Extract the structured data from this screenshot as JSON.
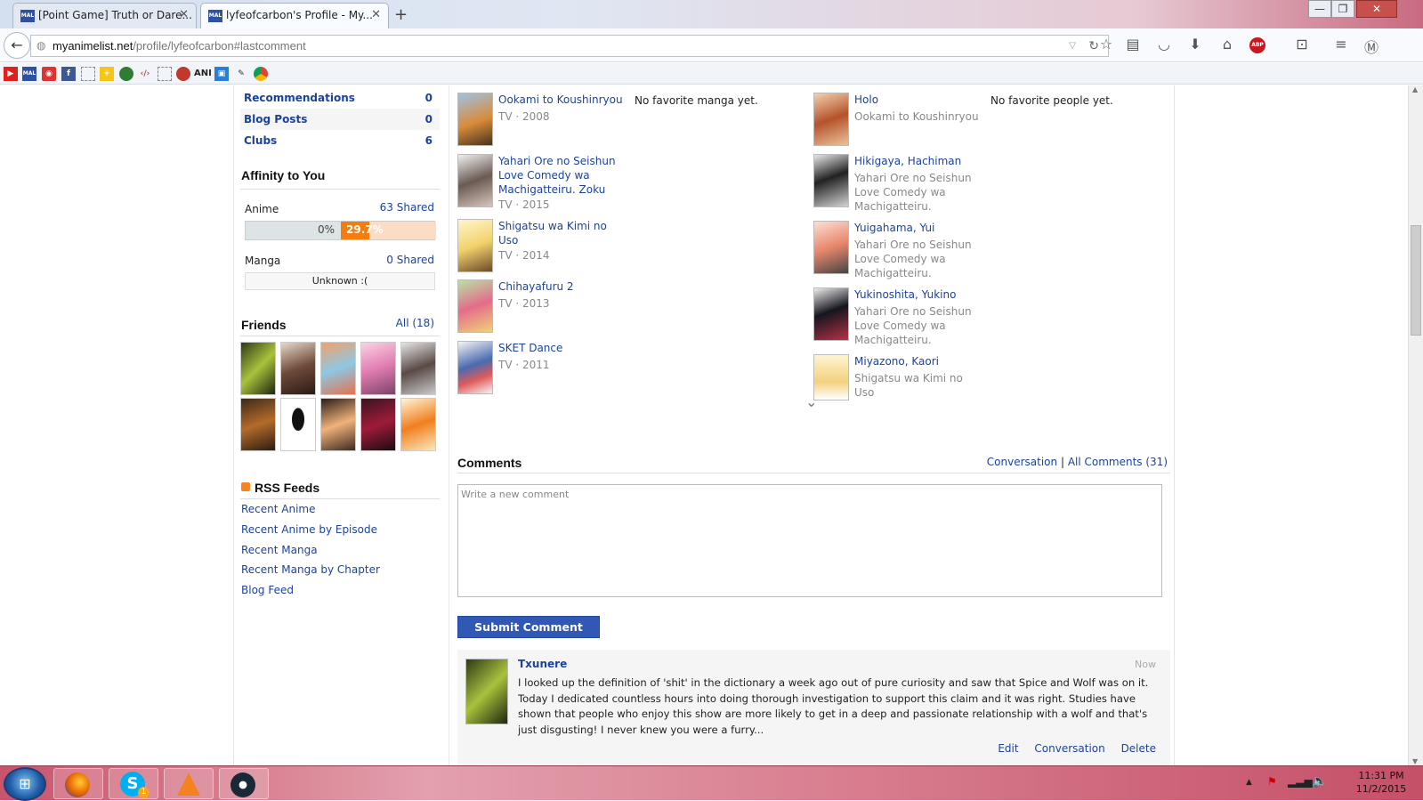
{
  "browser": {
    "tabs": [
      {
        "title": "[Point Game] Truth or Dare...",
        "active": false
      },
      {
        "title": "lyfeofcarbon's Profile - My...",
        "active": true
      }
    ],
    "new_tab_label": "+",
    "window_controls": {
      "minimize": "—",
      "restore": "❐",
      "close": "✕"
    },
    "url_host": "myanimelist.net",
    "url_path": "/profile/lyfeofcarbon#lastcomment",
    "bookmarks": [
      "youtube-icon",
      "mal-icon",
      "record-icon",
      "facebook-icon",
      "blank-icon",
      "plus-icon",
      "green-icon",
      "code-icon",
      "blank-icon",
      "pokeball-icon",
      "ANI",
      "image-icon",
      "brush-icon",
      "chrome-icon"
    ],
    "bookmark_ani_label": "ANI",
    "abp_label": "ABP"
  },
  "stats": [
    {
      "label": "Recommendations",
      "value": "0"
    },
    {
      "label": "Blog Posts",
      "value": "0"
    },
    {
      "label": "Clubs",
      "value": "6"
    }
  ],
  "affinity": {
    "heading": "Affinity to You",
    "anime_label": "Anime",
    "anime_shared": "63 Shared",
    "anime_left_pct": "0%",
    "anime_right_pct": "29.7%",
    "anime_fill": 0.297,
    "manga_label": "Manga",
    "manga_shared": "0 Shared",
    "manga_value": "Unknown :("
  },
  "friends": {
    "heading": "Friends",
    "all_link": "All (18)",
    "count_shown": 10
  },
  "rss": {
    "heading": "RSS Feeds",
    "links": [
      "Recent Anime",
      "Recent Anime by Episode",
      "Recent Manga",
      "Recent Manga by Chapter",
      "Blog Feed"
    ]
  },
  "favorites": {
    "anime": [
      {
        "title": "Ookami to Koushinryou",
        "meta": "TV · 2008"
      },
      {
        "title": "Yahari Ore no Seishun Love Comedy wa Machigatteiru. Zoku",
        "meta": "TV · 2015"
      },
      {
        "title": "Shigatsu wa Kimi no Uso",
        "meta": "TV · 2014"
      },
      {
        "title": "Chihayafuru 2",
        "meta": "TV · 2013"
      },
      {
        "title": "SKET Dance",
        "meta": "TV · 2011"
      }
    ],
    "manga_empty": "No favorite manga yet.",
    "characters": [
      {
        "name": "Holo",
        "source": "Ookami to Koushinryou"
      },
      {
        "name": "Hikigaya, Hachiman",
        "source": "Yahari Ore no Seishun Love Comedy wa Machigatteiru."
      },
      {
        "name": "Yuigahama, Yui",
        "source": "Yahari Ore no Seishun Love Comedy wa Machigatteiru."
      },
      {
        "name": "Yukinoshita, Yukino",
        "source": "Yahari Ore no Seishun Love Comedy wa Machigatteiru."
      },
      {
        "name": "Miyazono, Kaori",
        "source": "Shigatsu wa Kimi no Uso"
      }
    ],
    "people_empty": "No favorite people yet."
  },
  "comments": {
    "heading": "Comments",
    "conversation_link": "Conversation",
    "separator": "|",
    "all_comments_link": "All Comments (31)",
    "placeholder": "Write a new comment",
    "submit_label": "Submit Comment",
    "items": [
      {
        "author": "Txunere",
        "time": "Now",
        "text": "I looked up the definition of 'shit' in the dictionary a week ago out of pure curiosity and saw that Spice and Wolf was on it. Today I dedicated countless hours into doing thorough investigation to support this claim and it was right. Studies have shown that people who enjoy this show are more likely to get in a deep and passionate relationship with a wolf and that's just disgusting! I never knew you were a furry...",
        "actions": [
          "Edit",
          "Conversation",
          "Delete"
        ]
      }
    ]
  },
  "taskbar": {
    "apps": [
      "firefox-icon",
      "skype-icon",
      "vlc-icon",
      "steam-icon"
    ],
    "skype_badge": "1",
    "time": "11:31 PM",
    "date": "11/2/2015"
  },
  "colors": {
    "link": "#1c439b",
    "submit": "#3058b4",
    "affinity_fill": "#f47d0f"
  }
}
